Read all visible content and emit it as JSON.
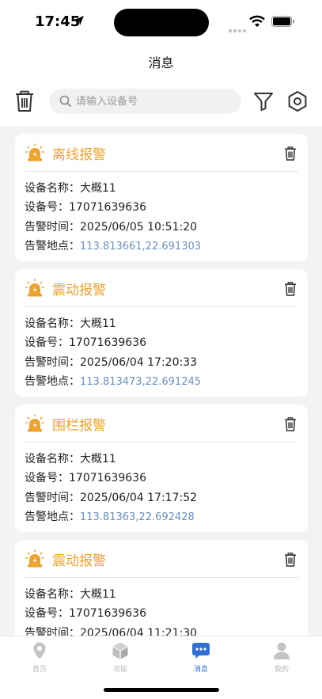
{
  "status": {
    "time": "17:45"
  },
  "header": {
    "title": "消息"
  },
  "search": {
    "placeholder": "请输入设备号",
    "value": ""
  },
  "colors": {
    "accent": "#f0a22e",
    "link": "#6a8fbf",
    "tab_active": "#2f6fd6",
    "tab_inactive": "#b8b8b8"
  },
  "labels": {
    "device_name": "设备名称：",
    "device_no": "设备号：",
    "alarm_time": "告警时间：",
    "alarm_place": "告警地点："
  },
  "messages": [
    {
      "title": "离线报警",
      "device_name": "大概11",
      "device_no": "17071639636",
      "time": "2025/06/05 10:51:20",
      "location": "113.813661,22.691303"
    },
    {
      "title": "震动报警",
      "device_name": "大概11",
      "device_no": "17071639636",
      "time": "2025/06/04 17:20:33",
      "location": "113.813473,22.691245"
    },
    {
      "title": "围栏报警",
      "device_name": "大概11",
      "device_no": "17071639636",
      "time": "2025/06/04 17:17:52",
      "location": "113.81363,22.692428"
    },
    {
      "title": "震动报警",
      "device_name": "大概11",
      "device_no": "17071639636",
      "time": "2025/06/04 11:21:30",
      "location": ""
    }
  ],
  "tabs": [
    {
      "label": "首页",
      "icon": "location-pin-icon",
      "active": false
    },
    {
      "label": "功能",
      "icon": "cube-icon",
      "active": false
    },
    {
      "label": "消息",
      "icon": "chat-bubble-icon",
      "active": true
    },
    {
      "label": "我的",
      "icon": "person-icon",
      "active": false
    }
  ]
}
